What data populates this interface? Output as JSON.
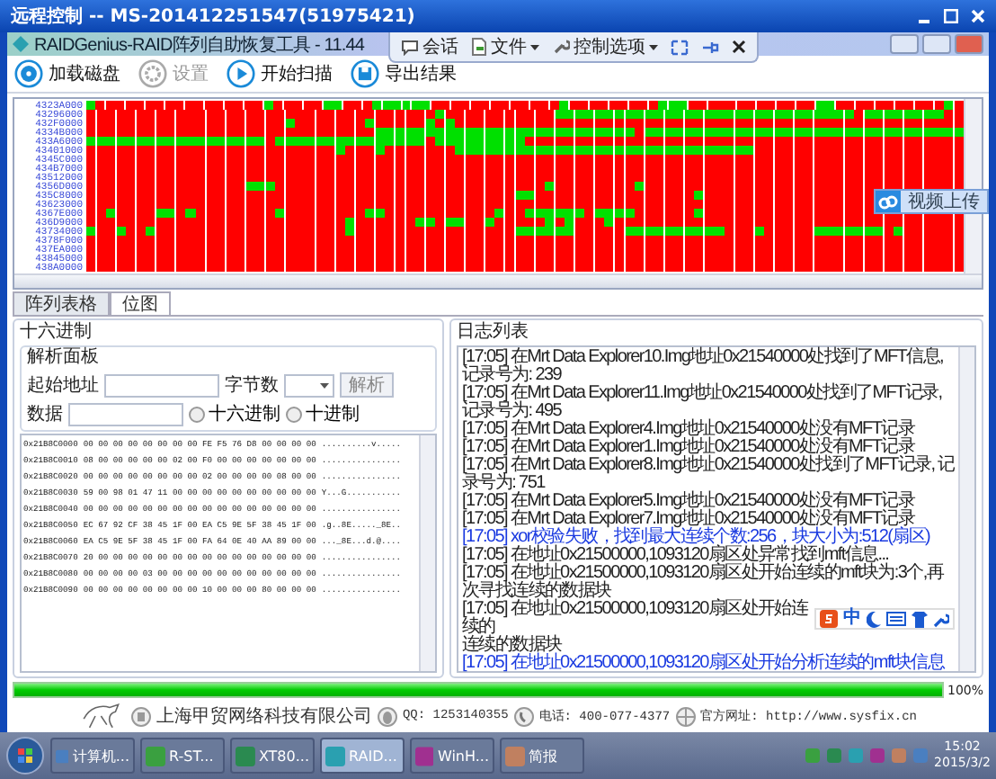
{
  "window": {
    "title": "远程控制 -- MS-201412251547(51975421)"
  },
  "app": {
    "title": "RAIDGenius-RAID阵列自助恢复工具 - 11.44"
  },
  "remote_bar": {
    "items": [
      {
        "label": "会话",
        "kind": "chat"
      },
      {
        "label": "文件",
        "kind": "file"
      },
      {
        "label": "控制选项",
        "kind": "tools"
      }
    ]
  },
  "toolbar": [
    {
      "label": "加载磁盘",
      "kind": "disk",
      "disabled": false
    },
    {
      "label": "设置",
      "kind": "gear",
      "disabled": true
    },
    {
      "label": "开始扫描",
      "kind": "play",
      "disabled": false
    },
    {
      "label": "导出结果",
      "kind": "save",
      "disabled": false
    }
  ],
  "bitmap": {
    "rows": [
      {
        "address": "4323A000"
      },
      {
        "address": "43296000"
      },
      {
        "address": "432F0000"
      },
      {
        "address": "4334B000"
      },
      {
        "address": "433A6000"
      },
      {
        "address": "43401000"
      },
      {
        "address": "4345C000"
      },
      {
        "address": "434B7000"
      },
      {
        "address": "43512000"
      },
      {
        "address": "4356D000"
      },
      {
        "address": "435C8000"
      },
      {
        "address": "43623000"
      },
      {
        "address": "4367E000"
      },
      {
        "address": "436D9000"
      },
      {
        "address": "43734000"
      },
      {
        "address": "4378F000"
      },
      {
        "address": "437EA000"
      },
      {
        "address": "43845000"
      },
      {
        "address": "438A0000"
      }
    ]
  },
  "upload_button": {
    "label": "视频上传"
  },
  "tabs": [
    {
      "label": "阵列表格",
      "selected": false
    },
    {
      "label": "位图",
      "selected": true
    }
  ],
  "hex_panel": {
    "title": "十六进制",
    "parse": {
      "title": "解析面板",
      "start_label": "起始地址",
      "bytes_label": "字节数",
      "parse_button": "解析",
      "data_label": "数据",
      "radios": [
        {
          "label": "十六进制",
          "selected": false
        },
        {
          "label": "十进制",
          "selected": false
        }
      ]
    },
    "rows": [
      {
        "address": "0x21B8C0000",
        "bytes": "00 00 00 00 00 00 00 00 FE F5 76 D8 00 00 00 00",
        "ascii": "..........v....."
      },
      {
        "address": "0x21B8C0010",
        "bytes": "08 00 00 00 00 00 02 00 F0 00 00 00 00 00 00 00",
        "ascii": "................"
      },
      {
        "address": "0x21B8C0020",
        "bytes": "00 00 00 00 00 00 00 00 02 00 00 00 00 08 00 00",
        "ascii": "................"
      },
      {
        "address": "0x21B8C0030",
        "bytes": "59 00 98 01 47 11 00 00 00 00 00 00 00 00 00 00",
        "ascii": "Y...G..........."
      },
      {
        "address": "0x21B8C0040",
        "bytes": "00 00 00 00 00 00 00 00 00 00 00 00 00 00 00 00",
        "ascii": "................"
      },
      {
        "address": "0x21B8C0050",
        "bytes": "EC 67 92 CF 38 45 1F 00 EA C5 9E 5F 38 45 1F 00",
        "ascii": ".g..8E....._8E.."
      },
      {
        "address": "0x21B8C0060",
        "bytes": "EA C5 9E 5F 38 45 1F 00 FA 64 0E 40 AA 89 00 00",
        "ascii": "..._8E...d.@...."
      },
      {
        "address": "0x21B8C0070",
        "bytes": "20 00 00 00 00 00 00 00 00 00 00 00 00 00 00 00",
        "ascii": "................"
      },
      {
        "address": "0x21B8C0080",
        "bytes": "00 00 00 00 03 00 00 00 00 00 00 00 00 00 00 00",
        "ascii": "................"
      },
      {
        "address": "0x21B8C0090",
        "bytes": "00 00 00 00 00 00 00 00 10 00 00 00 80 00 00 00",
        "ascii": "................"
      }
    ]
  },
  "log": {
    "title": "日志列表",
    "entries": [
      {
        "text": "[17:05] 在Mrt Data Explorer10.Img地址0x21540000处找到了MFT信息, 记录号为: 239",
        "kind": "info"
      },
      {
        "text": "[17:05] 在Mrt Data Explorer11.Img地址0x21540000处找到了MFT记录, 记录号为: 495",
        "kind": "info"
      },
      {
        "text": "[17:05] 在Mrt Data Explorer4.Img地址0x21540000处没有MFT记录",
        "kind": "info"
      },
      {
        "text": "[17:05] 在Mrt Data Explorer1.Img地址0x21540000处没有MFT记录",
        "kind": "info"
      },
      {
        "text": "[17:05] 在Mrt Data Explorer8.Img地址0x21540000处找到了MFT记录, 记录号为: 751",
        "kind": "info"
      },
      {
        "text": "[17:05] 在Mrt Data Explorer5.Img地址0x21540000处没有MFT记录",
        "kind": "info"
      },
      {
        "text": "[17:05] 在Mrt Data Explorer7.Img地址0x21540000处没有MFT记录",
        "kind": "info"
      },
      {
        "text": "[17:05] xor校验失败，找到最大连续个数:256，块大小为:512(扇区)",
        "kind": "highlight"
      },
      {
        "text": "[17:05] 在地址0x21500000,1093120扇区处异常找到mft信息...",
        "kind": "info"
      },
      {
        "text": "[17:05] 在地址0x21500000,1093120扇区处开始连续的mft块为:3个,再次寻找连续的数据块",
        "kind": "info"
      },
      {
        "text": "[17:05] 在地址0x21500000,1093120扇区处开始连续的",
        "kind": "covered"
      },
      {
        "text": "连续的数据块",
        "kind": "info"
      },
      {
        "text": "[17:05] 在地址0x21500000,1093120扇区处开始分析连续的mft块信息",
        "kind": "highlight"
      }
    ]
  },
  "ime_bar": {
    "label": "中"
  },
  "progress": {
    "level": 1,
    "reading": "100%"
  },
  "footer": {
    "company": "上海甲贸网络科技有限公司",
    "qq": "QQ: 1253140355",
    "phone": "电话: 400-077-4377",
    "website": "官方网址: http://www.sysfix.cn"
  },
  "taskbar": {
    "items": [
      {
        "label": "计算机...",
        "selected": false
      },
      {
        "label": "R-ST...",
        "selected": false
      },
      {
        "label": "XT80...",
        "selected": false
      },
      {
        "label": "RAID...",
        "selected": true
      },
      {
        "label": "WinH...",
        "selected": false
      },
      {
        "label": "简报",
        "selected": false
      }
    ],
    "time": "15:02",
    "date": "2015/3/2"
  }
}
